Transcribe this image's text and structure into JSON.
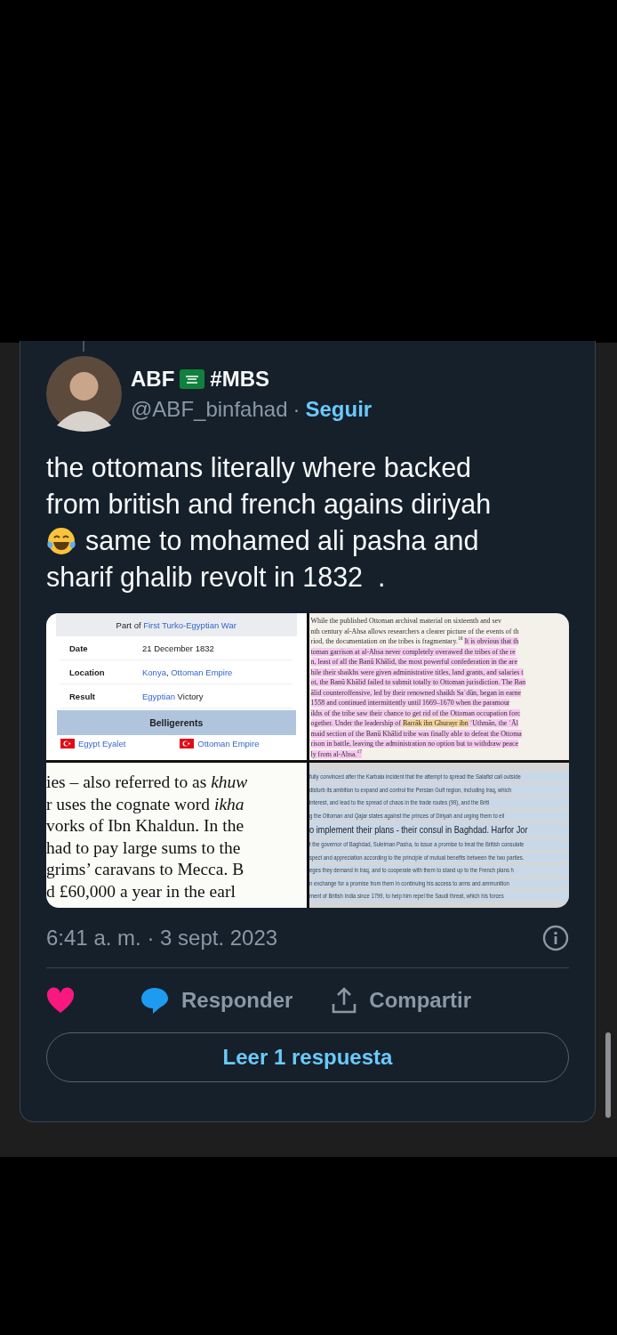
{
  "author": {
    "name": "ABF",
    "hashtag": "#MBS",
    "handle": "@ABF_binfahad",
    "separator": "·",
    "follow_label": "Seguir"
  },
  "tweet_text": [
    {
      "kind": "plain",
      "text": "the ottomans literally where backed"
    },
    {
      "kind": "plain",
      "text": "from british and french agains diriyah"
    },
    {
      "kind": "emoji_lead",
      "text": "same to mohamed ali pasha and"
    },
    {
      "kind": "plain",
      "text": "sharif ghalib revolt in 1832  ."
    }
  ],
  "media": [
    {
      "kind": "infobox",
      "caption": [
        {
          "text": "Part of ",
          "link": false
        },
        {
          "text": "First Turko-Egyptian War",
          "link": true
        }
      ],
      "rows": [
        {
          "label": "Date",
          "value": [
            {
              "text": "21 December 1832",
              "link": false
            }
          ]
        },
        {
          "label": "Location",
          "value": [
            {
              "text": "Konya",
              "link": true
            },
            {
              "text": ", ",
              "link": false
            },
            {
              "text": "Ottoman Empire",
              "link": true
            }
          ]
        },
        {
          "label": "Result",
          "value": [
            {
              "text": "Egyptian",
              "link": true
            },
            {
              "text": " Victory",
              "link": false
            }
          ]
        }
      ],
      "section": "Belligerents",
      "sides": [
        "Egypt Eyalet",
        "Ottoman Empire"
      ]
    },
    {
      "kind": "scan",
      "lines": [
        [
          {
            "text": "While the published Ottoman archival material on sixteenth and sev"
          }
        ],
        [
          {
            "text": "nth century al-Ahsa allows researchers a clearer picture of the events of th"
          }
        ],
        [
          {
            "text": "riod, the documentation on the tribes is fragmentary.$^{16}$ "
          },
          {
            "text": "It is obvious that th",
            "color": "#f6c8f0"
          }
        ],
        [
          {
            "text": "toman garrison at al-Ahsa never completely overawed the tribes of the re",
            "color": "#f6c8f0"
          }
        ],
        [
          {
            "text": "n, least of all the Banū Khālid, the most powerful confederation in the are",
            "color": "#f6c8f0"
          }
        ],
        [
          {
            "text": "hile their shaikhs were given administrative titles, land grants, and salaries t",
            "color": "#f6c8f0"
          }
        ],
        [
          {
            "text": "ot, the Banū Khālid failed to submit totally to Ottoman jurisdiction. The Ban",
            "color": "#f6c8f0"
          }
        ],
        [
          {
            "text": "ālid counteroffensive, led by their renowned shaikh Saʿdūn, began in earne",
            "color": "#f6c8f0"
          }
        ],
        [
          {
            "text": "1558 and continued intermittently until 1669–1670 when the paramour",
            "color": "#f6c8f0"
          }
        ],
        [
          {
            "text": "ikhs of the tribe saw their chance to get rid of the Ottoman occupation forc",
            "color": "#f6c8f0"
          }
        ],
        [
          {
            "text": "ogether. Under the leadership of ",
            "color": "#f6c8f0"
          },
          {
            "text": "Barrāk ibn Ghurayr ibn",
            "color": "#f6d39a"
          },
          {
            "text": " ʿUthmān, the ʾĀl",
            "color": "#f6c8f0"
          }
        ],
        [
          {
            "text": "maid section of the Banū Khālid tribe was finally able to defeat the Ottoma",
            "color": "#f6c8f0"
          }
        ],
        [
          {
            "text": "rison in battle, leaving the administration no option but to withdraw peace",
            "color": "#f6c8f0"
          }
        ],
        [
          {
            "text": "ly from al-Ahsa.$^{17}$",
            "color": "#f6c8f0"
          }
        ]
      ]
    },
    {
      "kind": "book",
      "lines": [
        "ies – also referred to as *khuw*",
        "r uses the cognate word *ikha*",
        "vorks of Ibn Khaldun. In the",
        "had to pay large sums to the",
        "grims’ caravans to Mecca. B",
        "d £60,000 a year in the earl"
      ]
    },
    {
      "kind": "translation",
      "lines": [
        {
          "kind": "small",
          "text": "fully convinced after the Karbala incident that the attempt to spread the Salafist call outside"
        },
        {
          "kind": "small",
          "text": "disturb its ambition to expand and control the Persian Gulf region, including Iraq, which"
        },
        {
          "kind": "small",
          "text": "interest, and lead to the spread of chaos in the trade routes (99), and the Briti"
        },
        {
          "kind": "small",
          "text": "g the Ottoman and Qajar states against the princes of Diriyah and urging them to eli"
        },
        {
          "kind": "large",
          "text": "o implement their plans - their consul in Baghdad. Harfor Jor"
        },
        {
          "kind": "small",
          "text": "t the governor of Baghdad, Suleiman Pasha, to issue a promise to treat the British consulate"
        },
        {
          "kind": "small",
          "text": "spect and appreciation according to the principle of mutual benefits between the two parties."
        },
        {
          "kind": "small",
          "text": "eges they demand in Iraq, and to cooperate with them to stand up to the French plans h"
        },
        {
          "kind": "small",
          "text": "n exchange for a promise from them In continuing his access to arms and ammunition"
        },
        {
          "kind": "small",
          "text": "ment of British India since 1799, to help him repel the Saudi threat, which his forces"
        }
      ]
    }
  ],
  "timestamp": "6:41 a. m. · 3 sept. 2023",
  "actions": [
    {
      "kind": "like"
    },
    {
      "kind": "reply",
      "label": "Responder"
    },
    {
      "kind": "share",
      "label": "Compartir"
    }
  ],
  "read_replies": "Leer 1 respuesta"
}
